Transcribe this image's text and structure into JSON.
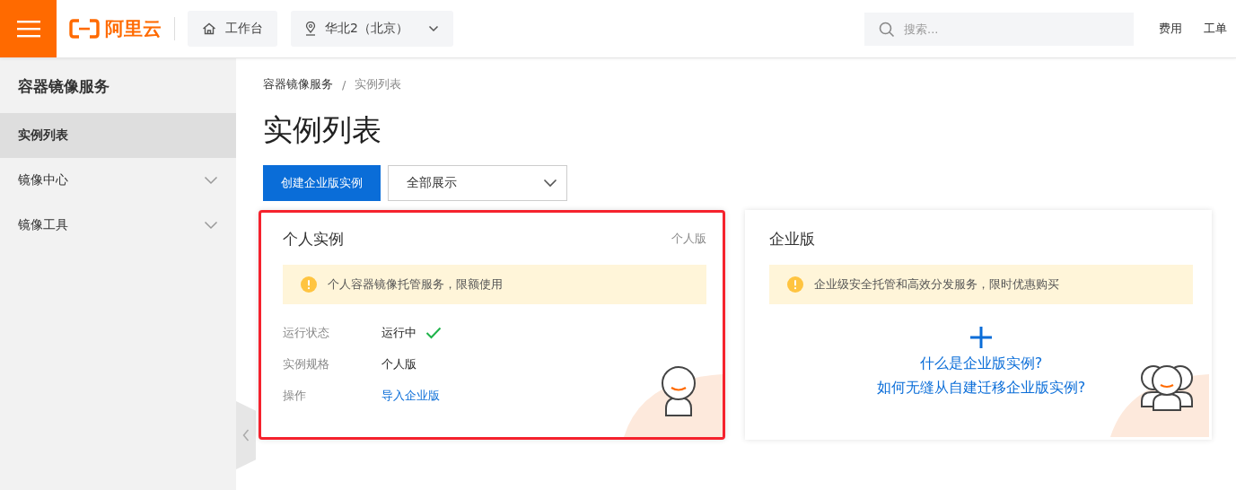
{
  "header": {
    "logo_text": "阿里云",
    "workbench": "工作台",
    "region": "华北2（北京）",
    "search": {
      "placeholder": "搜索..."
    },
    "links": [
      "费用",
      "工单"
    ]
  },
  "sidebar": {
    "title": "容器镜像服务",
    "items": [
      {
        "label": "实例列表",
        "selected": true,
        "kind": "link"
      },
      {
        "label": "镜像中心",
        "selected": false,
        "kind": "group",
        "expanded": false
      },
      {
        "label": "镜像工具",
        "selected": false,
        "kind": "group",
        "expanded": false
      }
    ]
  },
  "breadcrumb": [
    "容器镜像服务",
    "实例列表"
  ],
  "breadcrumb_separator": "/",
  "page_title": "实例列表",
  "create_button": "创建企业版实例",
  "filter": {
    "value": "全部展示"
  },
  "cards": [
    {
      "kind": "instance",
      "title": "个人实例",
      "tag": "个人版",
      "notice": "个人容器镜像托管服务，限额使用",
      "highlighted": true,
      "fields": [
        {
          "label": "运行状态",
          "value": "运行中",
          "kind": "status"
        },
        {
          "label": "实例规格",
          "value": "个人版",
          "kind": "text"
        },
        {
          "label": "操作",
          "value": "导入企业版",
          "kind": "link"
        }
      ]
    },
    {
      "kind": "promo",
      "title": "企业版",
      "notice": "企业级安全托管和高效分发服务，限时优惠购买",
      "highlighted": false,
      "links": [
        "什么是企业版实例?",
        "如何无缝从自建迁移企业版实例?"
      ]
    }
  ]
}
